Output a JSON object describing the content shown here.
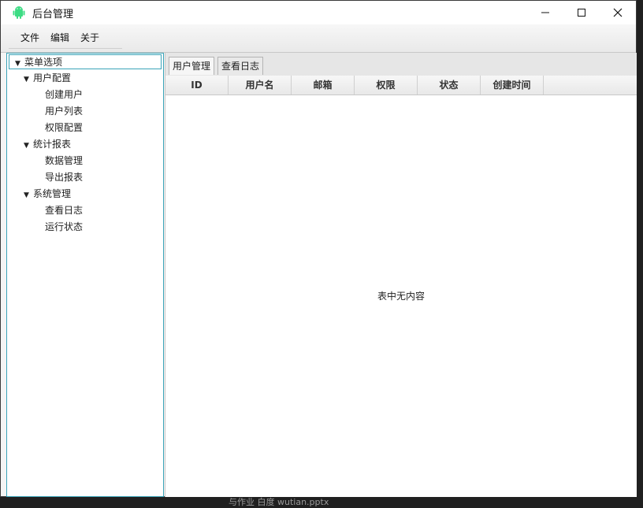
{
  "window": {
    "title": "后台管理"
  },
  "menubar": {
    "items": [
      "文件",
      "编辑",
      "关于"
    ]
  },
  "tree": {
    "root": "菜单选项",
    "groups": [
      {
        "label": "用户配置",
        "children": [
          "创建用户",
          "用户列表",
          "权限配置"
        ]
      },
      {
        "label": "统计报表",
        "children": [
          "数据管理",
          "导出报表"
        ]
      },
      {
        "label": "系统管理",
        "children": [
          "查看日志",
          "运行状态"
        ]
      }
    ]
  },
  "tabs": [
    "用户管理",
    "查看日志"
  ],
  "table": {
    "columns": [
      "ID",
      "用户名",
      "邮箱",
      "权限",
      "状态",
      "创建时间"
    ],
    "empty_message": "表中无内容"
  },
  "background": {
    "partial_text": "与作业 白度   wutian.pptx"
  },
  "colors": {
    "accent": "#3aa3b8",
    "app_icon": "#3ddc84"
  }
}
